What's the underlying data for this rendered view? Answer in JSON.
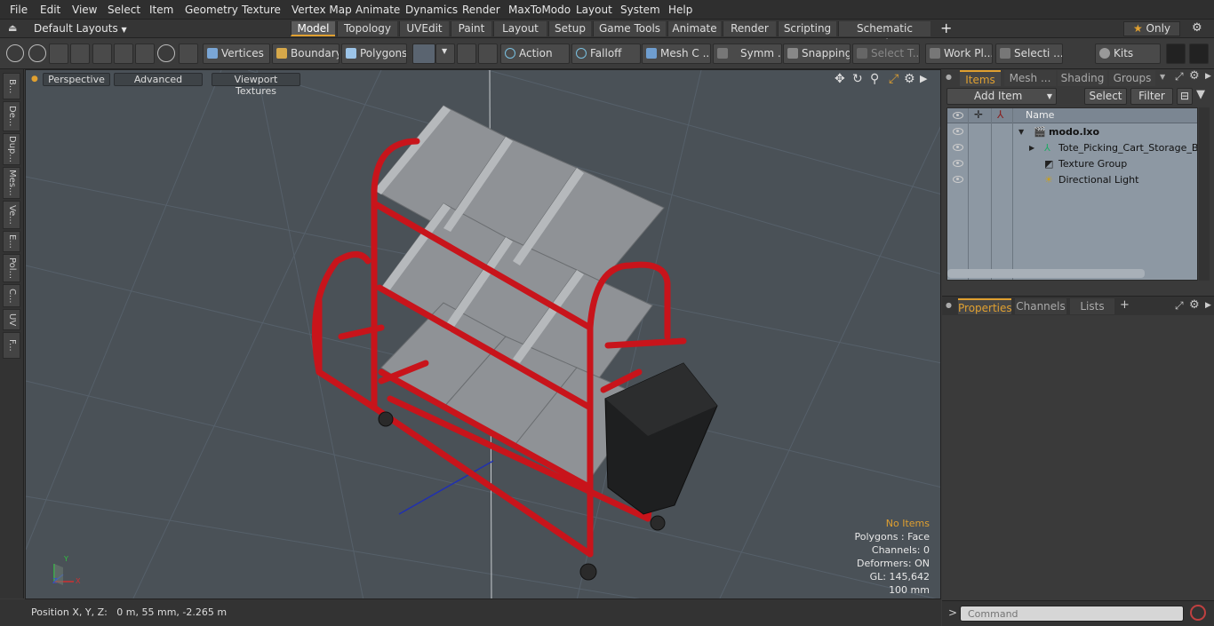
{
  "menubar": {
    "items": [
      "File",
      "Edit",
      "View",
      "Select",
      "Item",
      "Geometry",
      "Texture",
      "Vertex Map",
      "Animate",
      "Dynamics",
      "Render",
      "MaxToModo",
      "Layout",
      "System",
      "Help"
    ]
  },
  "modebar": {
    "layouts_label": "Default Layouts",
    "tabs": [
      "Model",
      "Topology",
      "UVEdit",
      "Paint",
      "Layout",
      "Setup",
      "Game Tools",
      "Animate",
      "Render",
      "Scripting",
      "Schematic Fusion"
    ],
    "add_tab": "+",
    "only_label": "Only",
    "star": "★"
  },
  "toolbar": {
    "vertices": "Vertices",
    "boundary": "Boundary",
    "polygons": "Polygons",
    "action": "Action",
    "falloff": "Falloff",
    "mesh_c": "Mesh C ...",
    "symm": "Symm ...",
    "snapping": "Snapping",
    "select_t": "Select T...",
    "work_pl": "Work Pl...",
    "selecti": "Selecti ...",
    "kits": "Kits"
  },
  "left_tabs": [
    "B...",
    "De...",
    "Dup...",
    "Mes...",
    "Ve...",
    "E...",
    "Pol...",
    "C...",
    "UV",
    "F..."
  ],
  "viewport": {
    "perspective": "Perspective",
    "advanced": "Advanced",
    "viewport_textures": "Viewport Textures",
    "info": {
      "no_items": "No Items",
      "polygons": "Polygons : Face",
      "channels": "Channels: 0",
      "deformers": "Deformers: ON",
      "gl": "GL: 145,642",
      "scale": "100 mm"
    },
    "axis_labels": {
      "y": "Y",
      "x": "X",
      "z": "Z"
    }
  },
  "statusbar": {
    "position": "Position X, Y, Z:   0 m, 55 mm, -2.265 m"
  },
  "items_panel": {
    "tabs": [
      "Items",
      "Mesh ...",
      "Shading",
      "Groups"
    ],
    "add_item": "Add Item",
    "select": "Select",
    "filter": "Filter",
    "column_name": "Name",
    "tree": [
      {
        "label": "modo.lxo",
        "bold": true
      },
      {
        "label": "Tote_Picking_Cart_Storage_B..."
      },
      {
        "label": "Texture Group"
      },
      {
        "label": "Directional Light"
      }
    ]
  },
  "properties_panel": {
    "tabs": [
      "Properties",
      "Channels",
      "Lists"
    ],
    "add": "+"
  },
  "command": {
    "placeholder": "Command",
    "prompt": ">"
  },
  "colors": {
    "accent": "#e0a030",
    "cart_red": "#c8141b",
    "bin_grey": "#8f9296",
    "viewport_bg": "#4a5157"
  }
}
